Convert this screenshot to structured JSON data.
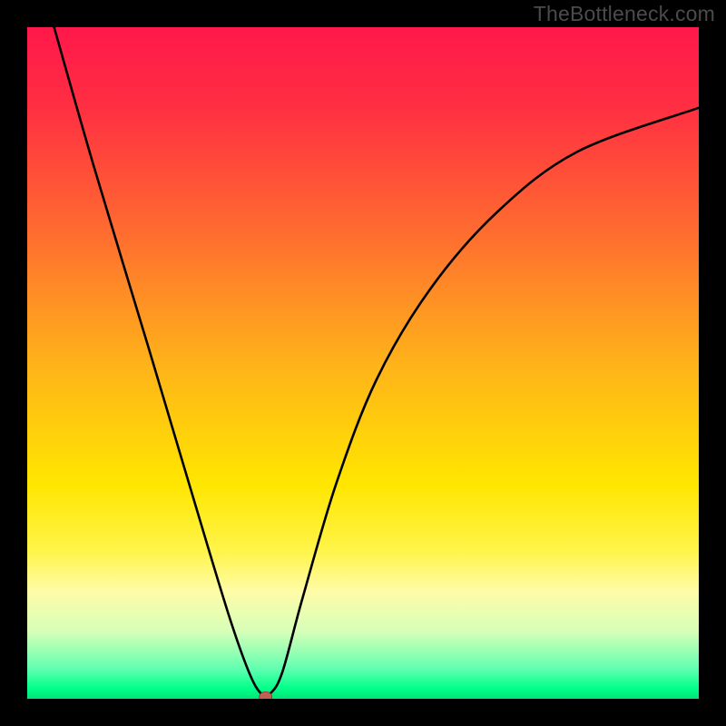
{
  "watermark": "TheBottleneck.com",
  "chart_data": {
    "type": "line",
    "title": "",
    "xlabel": "",
    "ylabel": "",
    "xlim": [
      0,
      100
    ],
    "ylim": [
      0,
      100
    ],
    "gradient_stops": [
      {
        "offset": 0.0,
        "color": "#ff184a"
      },
      {
        "offset": 0.12,
        "color": "#ff2f42"
      },
      {
        "offset": 0.3,
        "color": "#ff6a30"
      },
      {
        "offset": 0.5,
        "color": "#ffb21a"
      },
      {
        "offset": 0.68,
        "color": "#ffe600"
      },
      {
        "offset": 0.78,
        "color": "#fff44a"
      },
      {
        "offset": 0.84,
        "color": "#fffca8"
      },
      {
        "offset": 0.9,
        "color": "#d6ffb8"
      },
      {
        "offset": 0.955,
        "color": "#62ffb0"
      },
      {
        "offset": 0.985,
        "color": "#00ff8a"
      },
      {
        "offset": 1.0,
        "color": "#00e574"
      }
    ],
    "series": [
      {
        "name": "curve",
        "color": "#000000",
        "points": [
          {
            "x": 4.0,
            "y": 100.0
          },
          {
            "x": 10.0,
            "y": 79.0
          },
          {
            "x": 18.0,
            "y": 52.5
          },
          {
            "x": 25.0,
            "y": 29.0
          },
          {
            "x": 30.0,
            "y": 12.5
          },
          {
            "x": 33.0,
            "y": 4.0
          },
          {
            "x": 34.8,
            "y": 0.8
          },
          {
            "x": 36.2,
            "y": 0.8
          },
          {
            "x": 38.0,
            "y": 4.0
          },
          {
            "x": 41.0,
            "y": 15.0
          },
          {
            "x": 46.0,
            "y": 32.0
          },
          {
            "x": 52.0,
            "y": 47.5
          },
          {
            "x": 60.0,
            "y": 61.0
          },
          {
            "x": 70.0,
            "y": 72.5
          },
          {
            "x": 82.0,
            "y": 81.5
          },
          {
            "x": 100.0,
            "y": 88.0
          }
        ]
      }
    ],
    "marker": {
      "x": 35.5,
      "y": 0.3,
      "color": "#c06050"
    },
    "description": "V-shaped bottleneck curve over rainbow gradient. Minimum near x≈35. Left branch is steep and straight from top-left to the minimum; right branch rises with decreasing slope toward the right edge at roughly 88% height."
  }
}
